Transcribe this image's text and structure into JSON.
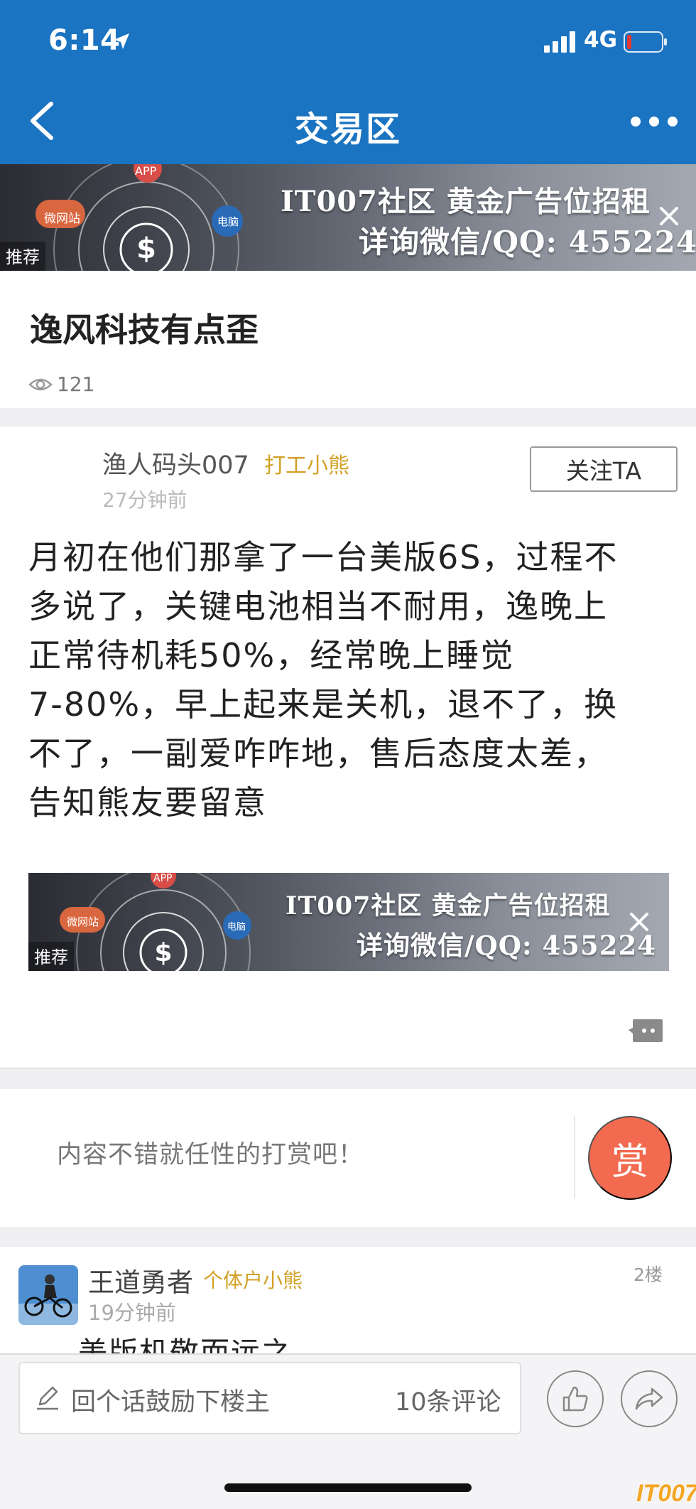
{
  "status_bar": {
    "time": "6:14",
    "network": "4G",
    "icons": [
      "location-arrow-icon",
      "signal-icon",
      "battery-icon"
    ]
  },
  "nav": {
    "title": "交易区",
    "back_icon": "chevron-left-icon",
    "more_icon": "more-dots-icon"
  },
  "ads": {
    "line1": "IT007社区  黄金广告位招租",
    "line2": "详询微信/QQ: 455224",
    "tag": "推荐",
    "bubbles": [
      "APP",
      "微网站",
      "电脑"
    ],
    "close_icon": "close-icon"
  },
  "post": {
    "title": "逸风科技有点歪",
    "views": "121",
    "author": {
      "name": "渔人码头007",
      "rank": "打工小熊",
      "time": "27分钟前",
      "follow_label": "关注TA"
    },
    "body_lines": [
      "月初在他们那拿了一台美版6S，过程不",
      "多说了，关键电池相当不耐用，逸晚上",
      "正常待机耗50%，经常晚上睡觉",
      "7-80%，早上起来是关机，退不了，换",
      "不了，一副爱咋咋地，售后态度太差，",
      "告知熊友要留意"
    ]
  },
  "reward": {
    "prompt": "内容不错就任性的打赏吧！",
    "button_label": "赏"
  },
  "comment": {
    "name": "王道勇者",
    "rank": "个体户小熊",
    "floor": "2楼",
    "time": "19分钟前",
    "text": "美版机敬而远之"
  },
  "bottom_bar": {
    "reply_placeholder": "回个话鼓励下楼主",
    "comment_count": "10条评论",
    "icons": [
      "edit-icon",
      "thumbs-up-icon",
      "share-icon"
    ]
  },
  "watermark": "IT007",
  "colors": {
    "nav_blue": "#1b74c1",
    "reward_red": "#f26a4f",
    "rank_gold": "#d2a024"
  }
}
